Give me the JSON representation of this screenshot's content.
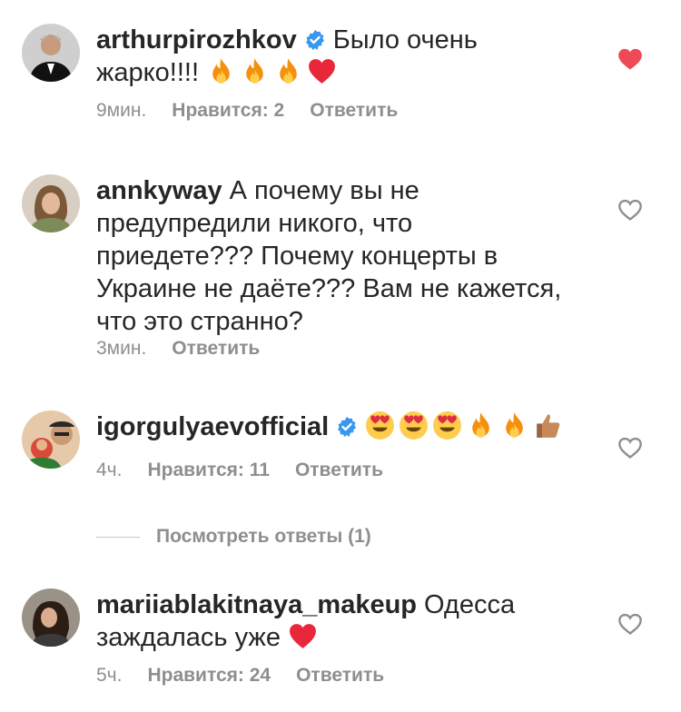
{
  "comments": [
    {
      "username": "arthurpirozhkov",
      "verified": true,
      "text": "Было очень жарко!!!!",
      "emojis": [
        "fire",
        "fire",
        "fire",
        "red-heart"
      ],
      "time": "9мин.",
      "likes": "Нравится: 2",
      "reply": "Ответить",
      "liked": true
    },
    {
      "username": "annkyway",
      "verified": false,
      "text": "А почему вы не предупредили никого, что приедете??? Почему концерты в Украине не даёте??? Вам не кажется, что это странно?",
      "time": "3мин.",
      "reply": "Ответить",
      "liked": false
    },
    {
      "username": "igorgulyaevofficial",
      "verified": true,
      "emojis": [
        "heart-eyes",
        "heart-eyes",
        "heart-eyes",
        "fire",
        "fire",
        "thumbs-up"
      ],
      "time": "4ч.",
      "likes": "Нравится: 11",
      "reply": "Ответить",
      "liked": false
    },
    {
      "username": "mariiablakitnaya_makeup",
      "verified": false,
      "text": "Одесса заждалась уже",
      "emojis": [
        "red-heart"
      ],
      "time": "5ч.",
      "likes": "Нравится: 24",
      "reply": "Ответить",
      "liked": false
    }
  ],
  "view_replies": "Посмотреть ответы (1)",
  "colors": {
    "text": "#262626",
    "meta": "#8e8e8e",
    "verified": "#3897f0",
    "liked_heart": "#ed4956"
  }
}
